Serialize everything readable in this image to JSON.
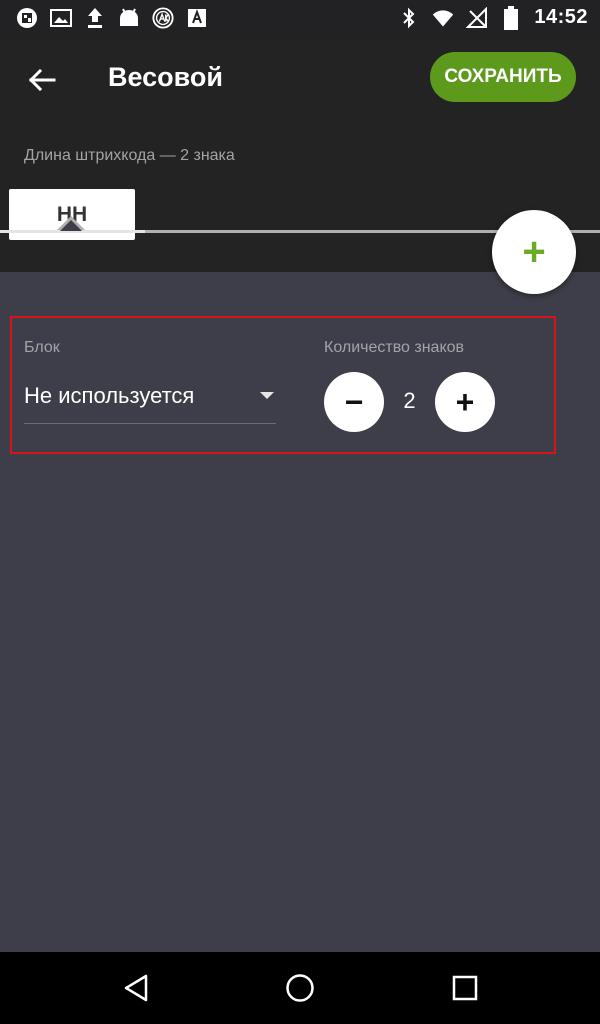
{
  "status_bar": {
    "time": "14:52",
    "left_icons": [
      "app-notification-icon",
      "image-icon",
      "upload-icon",
      "android-icon",
      "ak-badge-icon",
      "font-a-icon"
    ],
    "right_icons": [
      "bluetooth-icon",
      "wifi-icon",
      "no-signal-icon",
      "battery-icon"
    ]
  },
  "toolbar": {
    "title": "Весовой",
    "save_label": "СОХРАНИТЬ",
    "subtitle": "Длина штрихкода — 2 знака",
    "chip_label": "НН",
    "fab_label": "+"
  },
  "block": {
    "block_label": "Блок",
    "block_value": "Не используется",
    "count_label": "Количество знаков",
    "count_value": "2",
    "minus_label": "−",
    "plus_label": "+"
  },
  "colors": {
    "accent_green": "#5d9a1c",
    "fab_plus_green": "#6aab26",
    "highlight_red": "#d6141c",
    "toolbar_bg": "#232323",
    "content_bg": "#3e3e4a"
  }
}
